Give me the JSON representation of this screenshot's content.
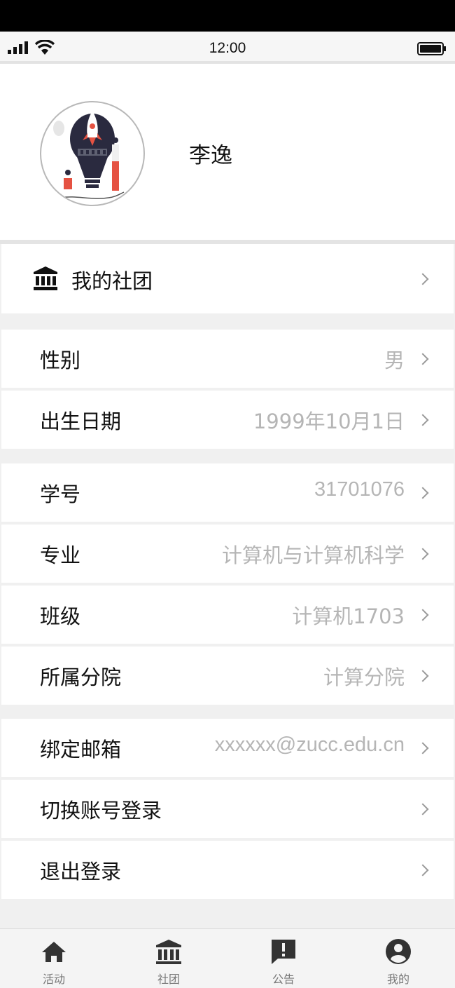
{
  "status_bar": {
    "time": "12:00"
  },
  "profile": {
    "name": "李逸"
  },
  "my_club": {
    "label": "我的社团"
  },
  "rows": [
    {
      "label": "性别",
      "value": "男"
    },
    {
      "label": "出生日期",
      "value": "1999年10月1日"
    },
    {
      "label": "学号",
      "value": "31701076"
    },
    {
      "label": "专业",
      "value": "计算机与计算机科学"
    },
    {
      "label": "班级",
      "value": "计算机1703"
    },
    {
      "label": "所属分院",
      "value": "计算分院"
    },
    {
      "label": "绑定邮箱",
      "value": "xxxxxx@zucc.edu.cn"
    },
    {
      "label": "切换账号登录",
      "value": ""
    },
    {
      "label": "退出登录",
      "value": ""
    }
  ],
  "tabbar": {
    "tabs": [
      {
        "label": "活动",
        "icon": "home-icon"
      },
      {
        "label": "社团",
        "icon": "institution-icon"
      },
      {
        "label": "公告",
        "icon": "announcement-icon"
      },
      {
        "label": "我的",
        "icon": "user-icon"
      }
    ]
  }
}
